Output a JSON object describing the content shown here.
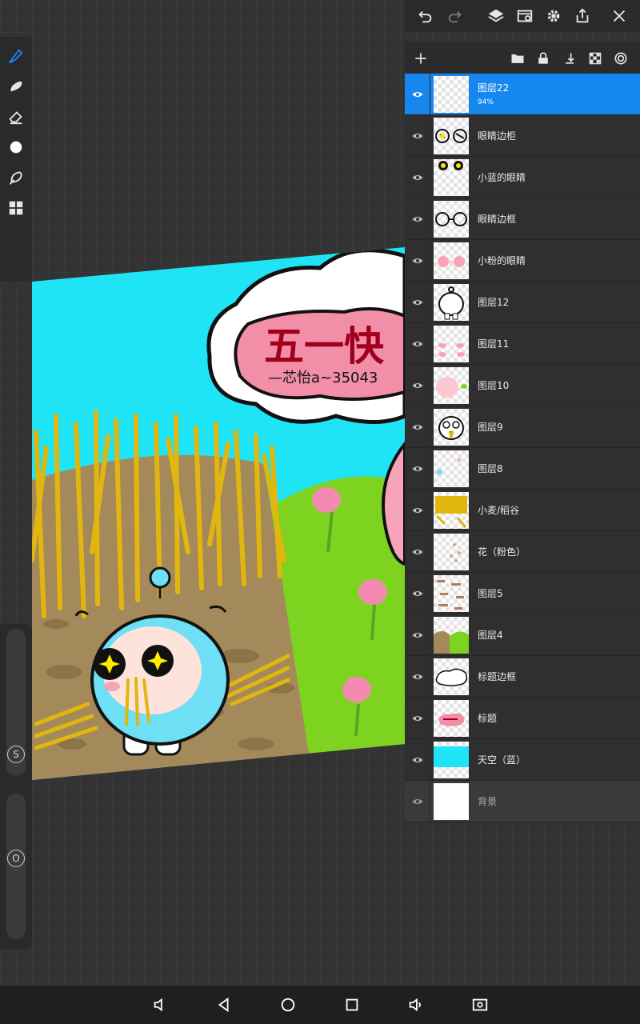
{
  "app": {
    "accent": "#1787f0",
    "panel_bg": "#2b2b2b"
  },
  "artwork": {
    "title_text": "五一快",
    "subtitle_text": "—芯怡a~35043"
  },
  "tools": [
    {
      "name": "brush",
      "icon": "brush-icon",
      "active": true
    },
    {
      "name": "smudge",
      "icon": "smudge-icon"
    },
    {
      "name": "eraser",
      "icon": "eraser-icon"
    },
    {
      "name": "color",
      "icon": "color-dot-icon"
    },
    {
      "name": "lasso",
      "icon": "lasso-icon"
    },
    {
      "name": "grid",
      "icon": "grid-icon"
    }
  ],
  "sliders": {
    "size_label": "S",
    "opacity_label": "O"
  },
  "top_bar": [
    "undo-icon",
    "redo-icon",
    "layers-icon",
    "gallery-icon",
    "settings-icon",
    "share-icon",
    "close-icon"
  ],
  "layers_header": [
    "add-layer-icon",
    "folder-icon",
    "lock-icon",
    "merge-down-icon",
    "checker-icon",
    "target-icon"
  ],
  "layers": [
    {
      "name": "图层22",
      "opacity": "94%",
      "selected": true
    },
    {
      "name": "眼睛边柜"
    },
    {
      "name": "小蓝的眼睛"
    },
    {
      "name": "眼睛边框"
    },
    {
      "name": "小粉的眼睛"
    },
    {
      "name": "图层12"
    },
    {
      "name": "图层11"
    },
    {
      "name": "图层10"
    },
    {
      "name": "图层9"
    },
    {
      "name": "图层8"
    },
    {
      "name": "小麦/稻谷"
    },
    {
      "name": "花（粉色）"
    },
    {
      "name": "图层5"
    },
    {
      "name": "图层4"
    },
    {
      "name": "标题边框"
    },
    {
      "name": "标题"
    },
    {
      "name": "天空（蓝）"
    },
    {
      "name": "背景",
      "dimmed": true
    }
  ],
  "nav_bar": [
    "volume-down-icon",
    "back-icon",
    "home-icon",
    "recents-icon",
    "volume-up-icon",
    "screenshot-icon"
  ]
}
